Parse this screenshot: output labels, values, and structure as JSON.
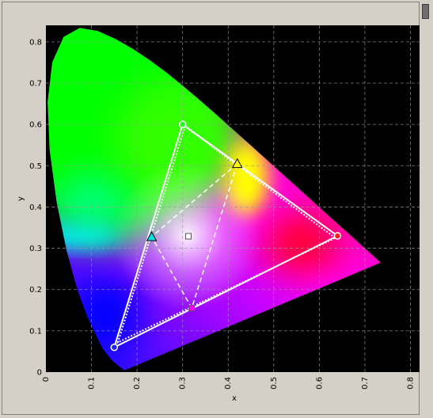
{
  "chart_data": {
    "type": "scatter",
    "title": "",
    "xlabel": "x",
    "ylabel": "y",
    "xlim": [
      0,
      0.82
    ],
    "ylim": [
      0,
      0.84
    ],
    "x_ticks": [
      "0",
      "0.1",
      "0.2",
      "0.3",
      "0.4",
      "0.5",
      "0.6",
      "0.7",
      "0.8"
    ],
    "y_ticks": [
      "0",
      "0.1",
      "0.2",
      "0.3",
      "0.4",
      "0.5",
      "0.6",
      "0.7",
      "0.8"
    ],
    "grid": true,
    "background": "#000000",
    "gamut_solid": [
      [
        0.64,
        0.33
      ],
      [
        0.3,
        0.6
      ],
      [
        0.15,
        0.06
      ]
    ],
    "gamut_dotted": [
      [
        0.635,
        0.325
      ],
      [
        0.305,
        0.595
      ],
      [
        0.158,
        0.072
      ]
    ],
    "gamut_dashed": [
      [
        0.42,
        0.505
      ],
      [
        0.232,
        0.328
      ],
      [
        0.32,
        0.155
      ]
    ],
    "points": [
      {
        "x": 0.64,
        "y": 0.33,
        "marker": "circle",
        "fill": "#ff2020"
      },
      {
        "x": 0.3,
        "y": 0.6,
        "marker": "circle",
        "fill": "#20ff20"
      },
      {
        "x": 0.15,
        "y": 0.06,
        "marker": "circle",
        "fill": "#2020ff"
      },
      {
        "x": 0.42,
        "y": 0.505,
        "marker": "triangle",
        "fill": "#ffff00"
      },
      {
        "x": 0.232,
        "y": 0.328,
        "marker": "triangle",
        "fill": "#00e0e0"
      },
      {
        "x": 0.32,
        "y": 0.155,
        "marker": "square",
        "fill": "#ff00ff"
      },
      {
        "x": 0.3127,
        "y": 0.329,
        "marker": "square",
        "fill": "#ffffff"
      }
    ],
    "locus": [
      [
        0.1741,
        0.005
      ],
      [
        0.1738,
        0.0049
      ],
      [
        0.1733,
        0.0048
      ],
      [
        0.1726,
        0.0048
      ],
      [
        0.1714,
        0.0051
      ],
      [
        0.1689,
        0.0069
      ],
      [
        0.1644,
        0.0109
      ],
      [
        0.1566,
        0.0177
      ],
      [
        0.144,
        0.0297
      ],
      [
        0.1241,
        0.0578
      ],
      [
        0.0913,
        0.1327
      ],
      [
        0.0687,
        0.2007
      ],
      [
        0.0454,
        0.295
      ],
      [
        0.0235,
        0.4127
      ],
      [
        0.0082,
        0.5384
      ],
      [
        0.0039,
        0.6548
      ],
      [
        0.0139,
        0.7502
      ],
      [
        0.0389,
        0.812
      ],
      [
        0.0743,
        0.8338
      ],
      [
        0.1142,
        0.8262
      ],
      [
        0.1547,
        0.8059
      ],
      [
        0.1929,
        0.7816
      ],
      [
        0.2296,
        0.7543
      ],
      [
        0.2658,
        0.7243
      ],
      [
        0.3016,
        0.6923
      ],
      [
        0.3373,
        0.6589
      ],
      [
        0.3731,
        0.6245
      ],
      [
        0.4087,
        0.5896
      ],
      [
        0.4441,
        0.5547
      ],
      [
        0.4788,
        0.5202
      ],
      [
        0.5125,
        0.4866
      ],
      [
        0.5448,
        0.4544
      ],
      [
        0.5752,
        0.4242
      ],
      [
        0.6029,
        0.3965
      ],
      [
        0.627,
        0.3725
      ],
      [
        0.6482,
        0.3514
      ],
      [
        0.6658,
        0.334
      ],
      [
        0.6801,
        0.3197
      ],
      [
        0.6915,
        0.3083
      ],
      [
        0.7006,
        0.2993
      ],
      [
        0.7079,
        0.292
      ],
      [
        0.714,
        0.2859
      ],
      [
        0.719,
        0.2809
      ],
      [
        0.723,
        0.277
      ],
      [
        0.726,
        0.274
      ],
      [
        0.7283,
        0.2717
      ],
      [
        0.73,
        0.27
      ],
      [
        0.7311,
        0.2689
      ],
      [
        0.732,
        0.268
      ],
      [
        0.7327,
        0.2673
      ],
      [
        0.7334,
        0.2666
      ],
      [
        0.734,
        0.266
      ],
      [
        0.7344,
        0.2656
      ],
      [
        0.7346,
        0.2654
      ],
      [
        0.7347,
        0.2653
      ]
    ]
  }
}
